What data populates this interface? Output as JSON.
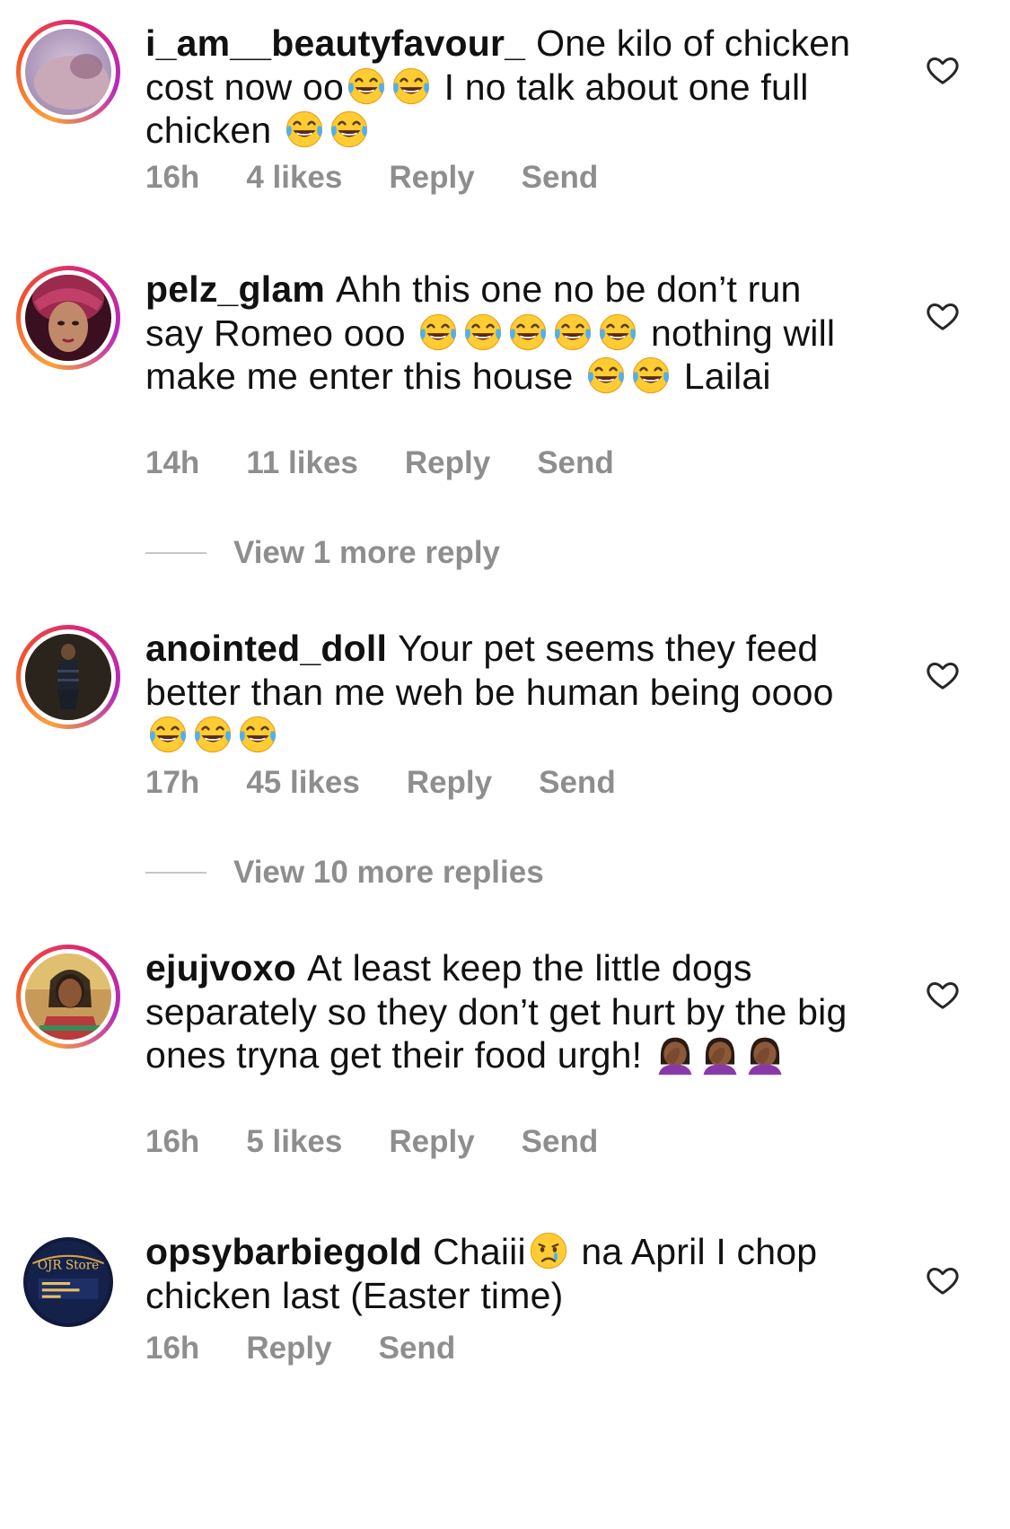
{
  "comments": [
    {
      "username": "i_am__beautyfavour_",
      "segments": [
        {
          "t": "One kilo of chicken cost now oo"
        },
        {
          "e": "joy"
        },
        {
          "e": "joy"
        },
        {
          "t": " I no talk about one full chicken "
        },
        {
          "e": "joy"
        },
        {
          "e": "joy"
        }
      ],
      "time": "16h",
      "likes": "4 likes",
      "reply": "Reply",
      "send": "Send"
    },
    {
      "username": "pelz_glam",
      "segments": [
        {
          "t": "Ahh this one no be don’t run say Romeo ooo "
        },
        {
          "e": "joy"
        },
        {
          "e": "joy"
        },
        {
          "e": "joy"
        },
        {
          "e": "joy"
        },
        {
          "e": "joy"
        },
        {
          "t": " nothing will make me enter this house "
        },
        {
          "e": "joy"
        },
        {
          "e": "joy"
        },
        {
          "t": " Lailai"
        }
      ],
      "time": "14h",
      "likes": "11 likes",
      "reply": "Reply",
      "send": "Send",
      "view_more": "View 1 more reply"
    },
    {
      "username": "anointed_doll",
      "segments": [
        {
          "t": "Your pet seems they feed better than me weh be human being oooo"
        },
        {
          "e": "joy"
        },
        {
          "e": "joy"
        },
        {
          "e": "joy"
        }
      ],
      "time": "17h",
      "likes": "45 likes",
      "reply": "Reply",
      "send": "Send",
      "view_more": "View 10 more replies"
    },
    {
      "username": "ejujvoxo",
      "segments": [
        {
          "t": "At least keep the little dogs separately so they don’t get hurt by the big ones tryna get their food urgh! "
        },
        {
          "e": "facepalm"
        },
        {
          "e": "facepalm"
        },
        {
          "e": "facepalm"
        }
      ],
      "time": "16h",
      "likes": "5 likes",
      "reply": "Reply",
      "send": "Send"
    },
    {
      "username": "opsybarbiegold",
      "segments": [
        {
          "t": "Chaiii"
        },
        {
          "e": "cry"
        },
        {
          "t": " na April I chop chicken last (Easter time)"
        }
      ],
      "time": "16h",
      "likes": "",
      "reply": "Reply",
      "send": "Send"
    }
  ],
  "icons": {
    "heart": "heart-outline-icon",
    "joy": "face-with-tears-of-joy-emoji",
    "facepalm": "woman-facepalming-emoji",
    "cry": "crying-face-emoji"
  },
  "avatar_texts": {
    "opsybarbiegold_logo": "OJR Store"
  },
  "colors": {
    "text": "#111111",
    "meta": "#8e8e8e",
    "ring_start": "#f9a23b",
    "ring_end": "#b32bbf"
  }
}
